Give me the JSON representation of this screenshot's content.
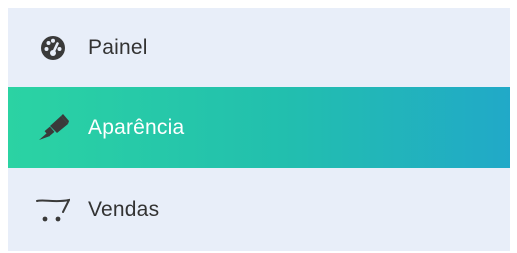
{
  "sidebar": {
    "items": [
      {
        "label": "Painel",
        "icon": "dashboard-icon",
        "active": false
      },
      {
        "label": "Aparência",
        "icon": "paintbrush-icon",
        "active": true
      },
      {
        "label": "Vendas",
        "icon": "shopping-cart-icon",
        "active": false
      }
    ]
  },
  "colors": {
    "background": "#e8eef9",
    "active_gradient_start": "#2bd3a3",
    "active_gradient_end": "#21a9c8",
    "text": "#333333",
    "active_text": "#ffffff"
  }
}
